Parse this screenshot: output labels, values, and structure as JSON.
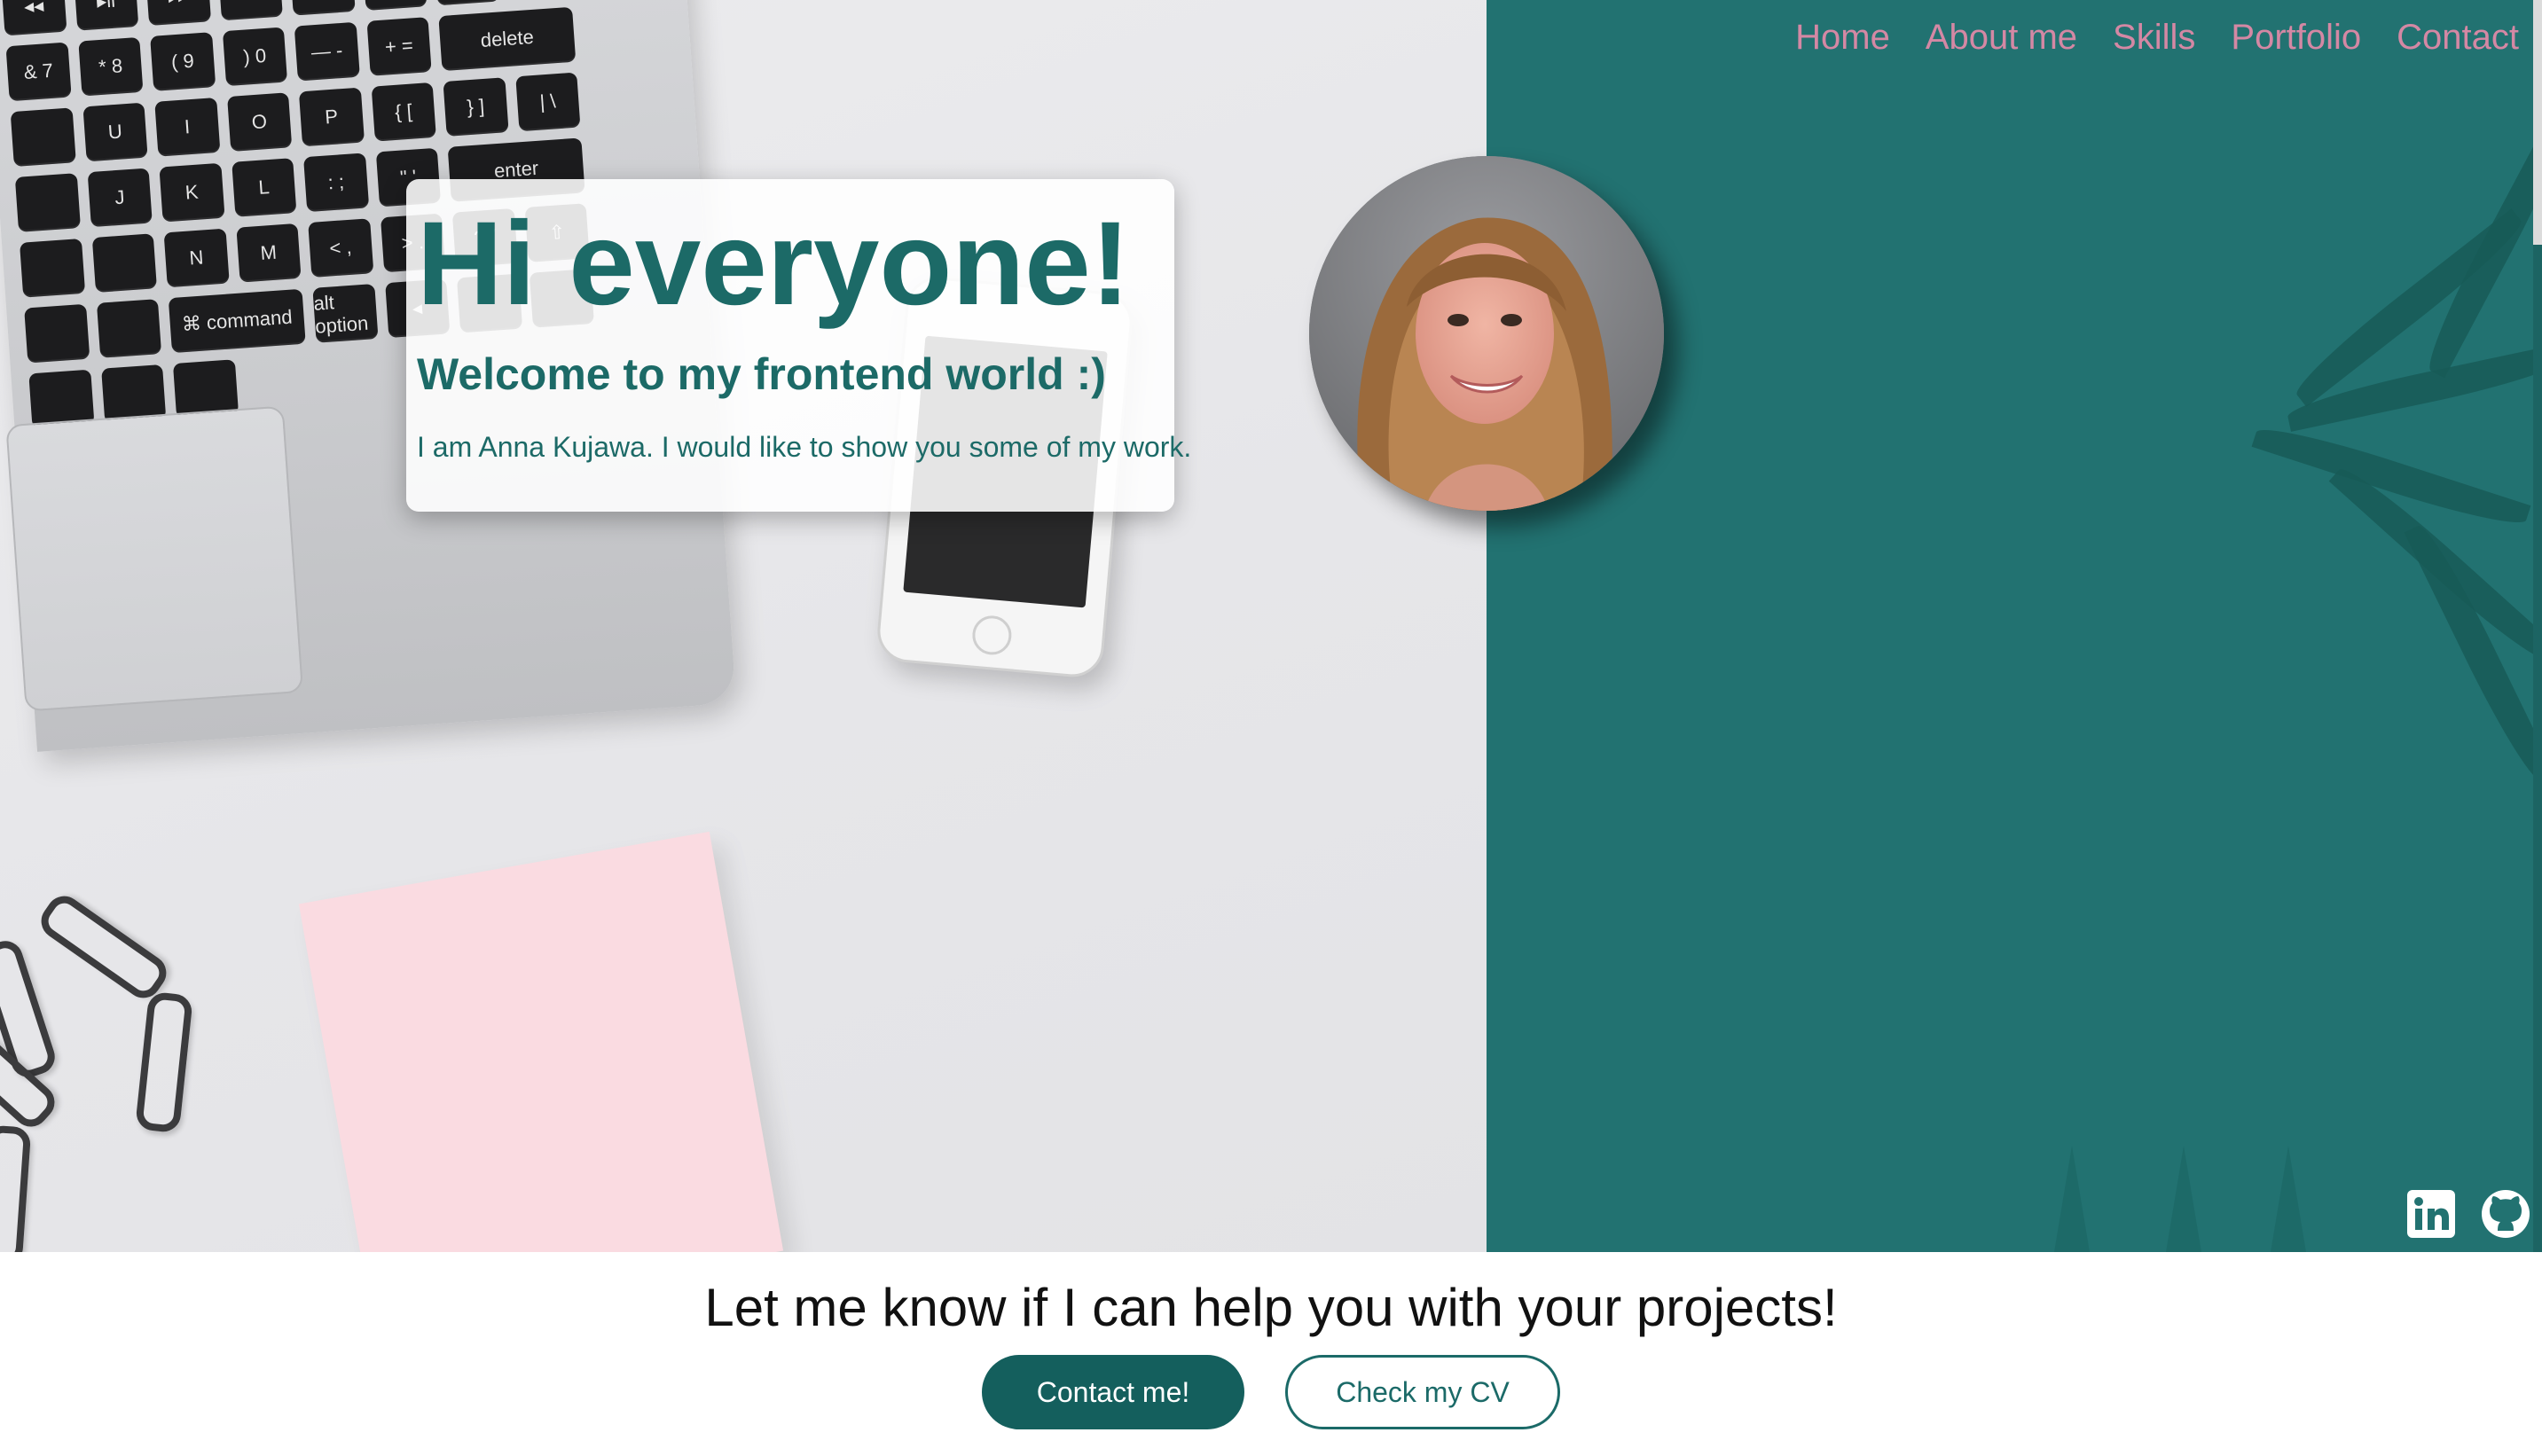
{
  "nav": {
    "items": [
      {
        "label": "Home"
      },
      {
        "label": "About me"
      },
      {
        "label": "Skills"
      },
      {
        "label": "Portfolio"
      },
      {
        "label": "Contact"
      }
    ]
  },
  "hero": {
    "title": "Hi everyone!",
    "subtitle": "Welcome to my frontend world :)",
    "intro": "I am Anna Kujawa. I would like to show you some of my work."
  },
  "keyboard": {
    "keys": [
      "◂◂",
      "▸ll",
      "▸▸",
      "◂",
      "◂)",
      "◂))",
      "",
      "",
      "&\n7",
      "*\n8",
      "(\n9",
      ")\n0",
      "—\n-",
      "+\n=",
      "delete",
      "",
      "U",
      "I",
      "O",
      "P",
      "{\n[",
      "}\n]",
      "|\n\\",
      "",
      "J",
      "K",
      "L",
      ":\n;",
      "\"\n'",
      "enter",
      "",
      "",
      "N",
      "M",
      "<\n,",
      ">\n.",
      "?\n/",
      "⇧",
      "",
      "",
      "⌘\ncommand",
      "alt\noption",
      "◂",
      "",
      "",
      "",
      "",
      ""
    ]
  },
  "social": {
    "linkedin_icon": "linkedin-icon",
    "github_icon": "github-icon"
  },
  "cta": {
    "title": "Let me know if I can help you with your projects!",
    "primary_label": "Contact me!",
    "secondary_label": "Check my CV"
  },
  "colors": {
    "teal": "#227271",
    "heading_teal": "#1c6a67",
    "nav_pink": "#d488a4",
    "button_teal": "#145f5d",
    "sticky_pink": "#fadbe1"
  }
}
